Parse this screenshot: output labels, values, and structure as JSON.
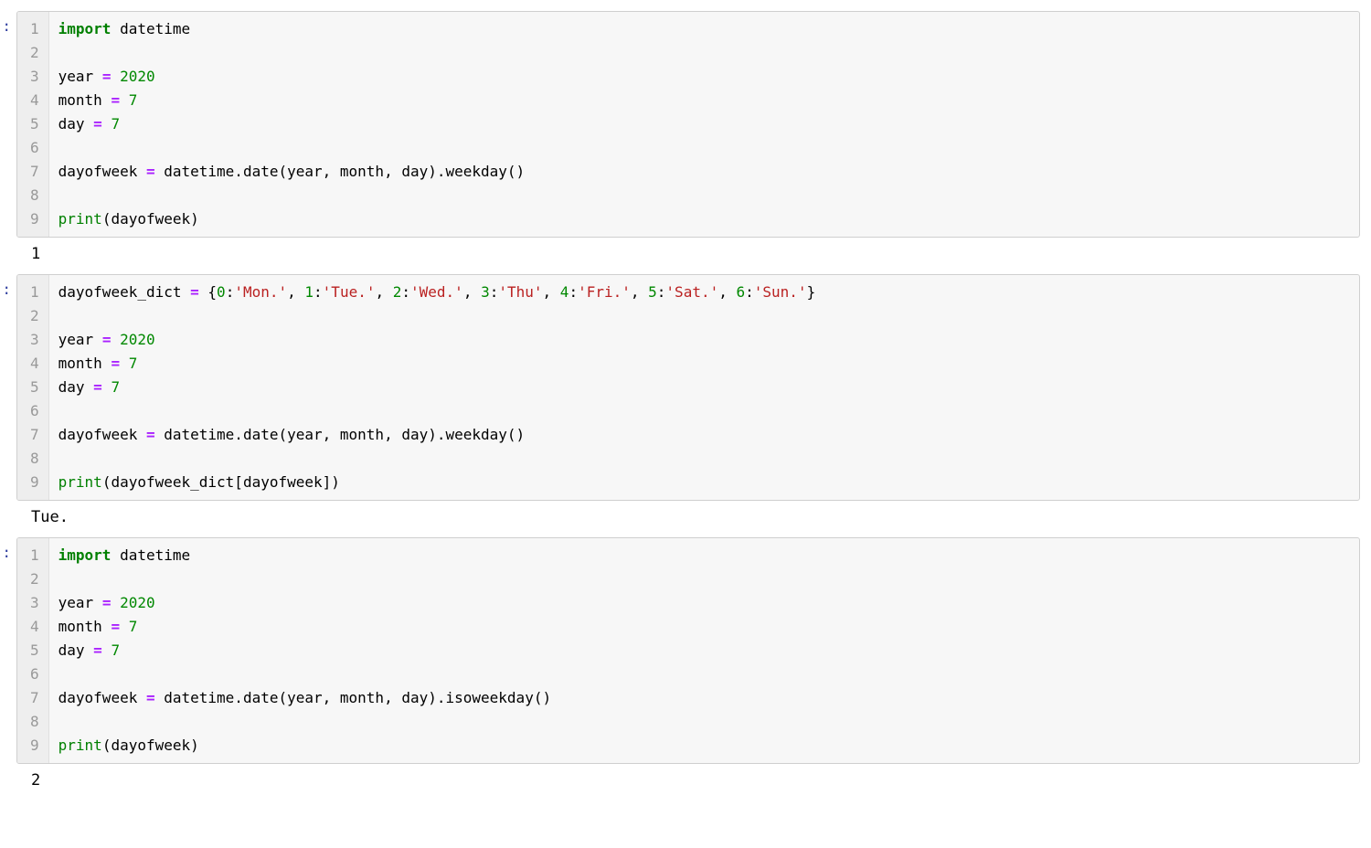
{
  "cells": [
    {
      "prompt": ":",
      "line_count": 9,
      "code_html": "<span class='line'><span class='kw'>import</span> datetime</span><span class='line'>&nbsp;</span><span class='line'>year <span class='op'>=</span> <span class='num'>2020</span></span><span class='line'>month <span class='op'>=</span> <span class='num'>7</span></span><span class='line'>day <span class='op'>=</span> <span class='num'>7</span></span><span class='line'>&nbsp;</span><span class='line'>dayofweek <span class='op'>=</span> datetime.date(year, month, day).weekday()</span><span class='line'>&nbsp;</span><span class='line'><span class='fn'>print</span>(dayofweek)</span>",
      "output": "1"
    },
    {
      "prompt": ":",
      "line_count": 9,
      "code_html": "<span class='line'>dayofweek_dict <span class='op'>=</span> {<span class='num'>0</span>:<span class='str'>'Mon.'</span>, <span class='num'>1</span>:<span class='str'>'Tue.'</span>, <span class='num'>2</span>:<span class='str'>'Wed.'</span>, <span class='num'>3</span>:<span class='str'>'Thu'</span>, <span class='num'>4</span>:<span class='str'>'Fri.'</span>, <span class='num'>5</span>:<span class='str'>'Sat.'</span>, <span class='num'>6</span>:<span class='str'>'Sun.'</span>}</span><span class='line'>&nbsp;</span><span class='line'>year <span class='op'>=</span> <span class='num'>2020</span></span><span class='line'>month <span class='op'>=</span> <span class='num'>7</span></span><span class='line'>day <span class='op'>=</span> <span class='num'>7</span></span><span class='line'>&nbsp;</span><span class='line'>dayofweek <span class='op'>=</span> datetime.date(year, month, day).weekday()</span><span class='line'>&nbsp;</span><span class='line'><span class='fn'>print</span>(dayofweek_dict[dayofweek])</span>",
      "output": "Tue."
    },
    {
      "prompt": ":",
      "line_count": 9,
      "code_html": "<span class='line'><span class='kw'>import</span> datetime</span><span class='line'>&nbsp;</span><span class='line'>year <span class='op'>=</span> <span class='num'>2020</span></span><span class='line'>month <span class='op'>=</span> <span class='num'>7</span></span><span class='line'>day <span class='op'>=</span> <span class='num'>7</span></span><span class='line'>&nbsp;</span><span class='line'>dayofweek <span class='op'>=</span> datetime.date(year, month, day).isoweekday()</span><span class='line'>&nbsp;</span><span class='line'><span class='fn'>print</span>(dayofweek)</span>",
      "output": "2"
    }
  ]
}
